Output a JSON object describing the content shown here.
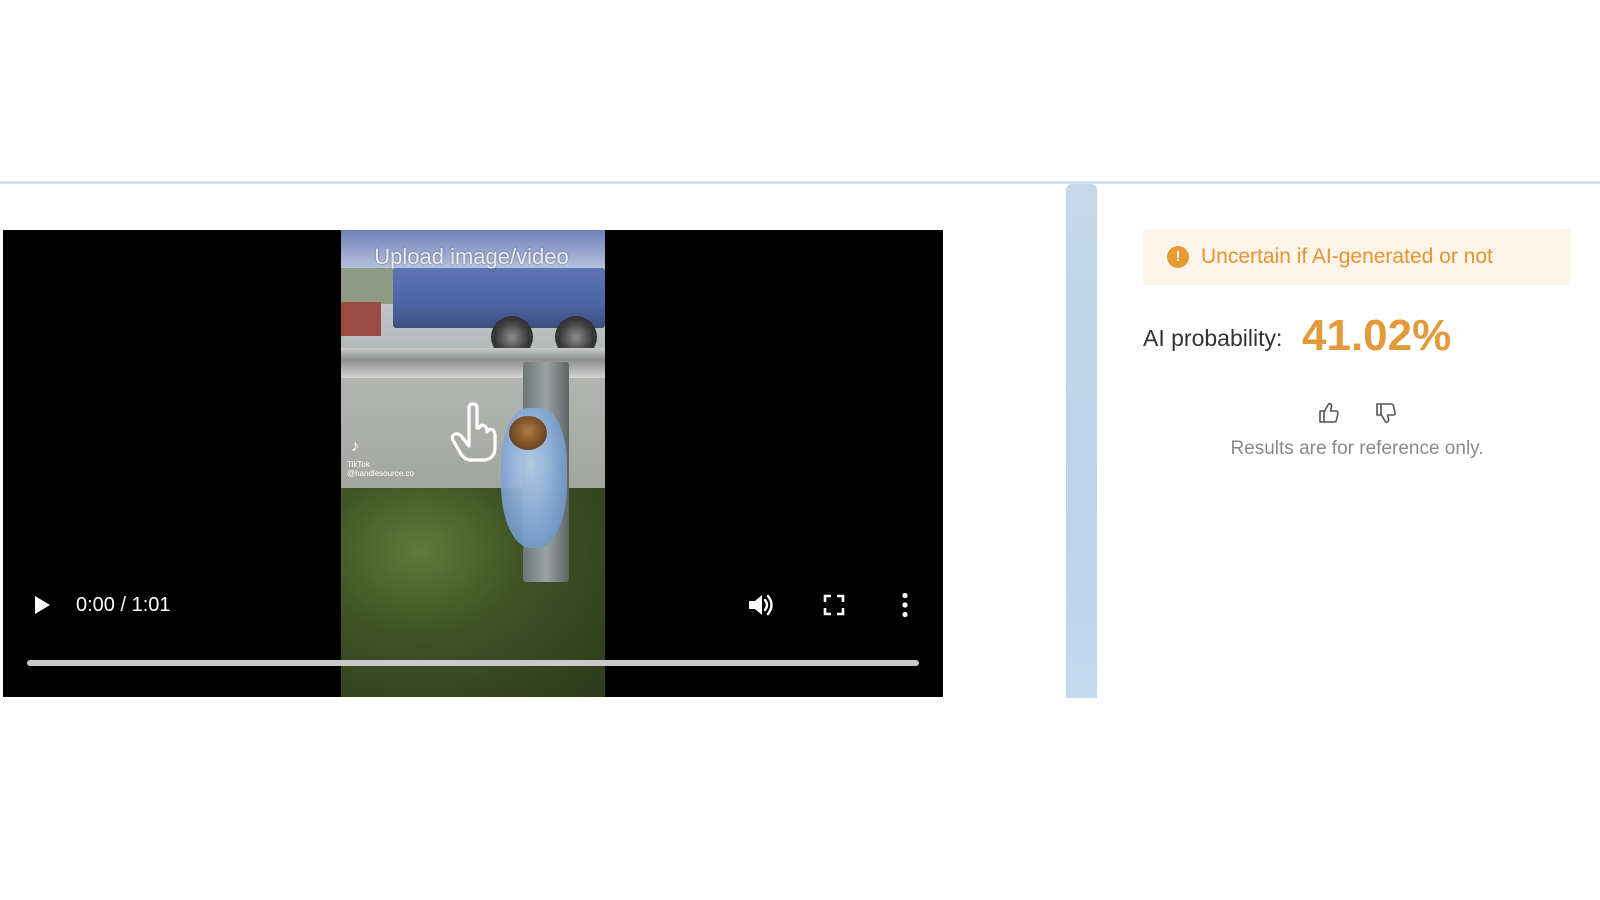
{
  "video": {
    "time_display": "0:00 / 1:01",
    "overlay_text": "Upload image/video",
    "watermark": "TikTok",
    "watermark_handle": "@handlesource.co",
    "progress": 0
  },
  "result": {
    "status_text": "Uncertain if AI-generated or not",
    "status_icon": "exclamation",
    "probability_label": "AI probability:",
    "probability_value": "41.02%",
    "note": "Results are for reference only."
  },
  "colors": {
    "accent": "#e39a3a",
    "alert_bg": "#fdf4ea",
    "gutter": "#bcd3ea"
  },
  "icons": {
    "play": "play-icon",
    "volume": "volume-icon",
    "fullscreen": "fullscreen-icon",
    "more": "more-vertical-icon",
    "upload": "hand-pointer-icon",
    "thumb_up": "thumbs-up-icon",
    "thumb_down": "thumbs-down-icon"
  }
}
